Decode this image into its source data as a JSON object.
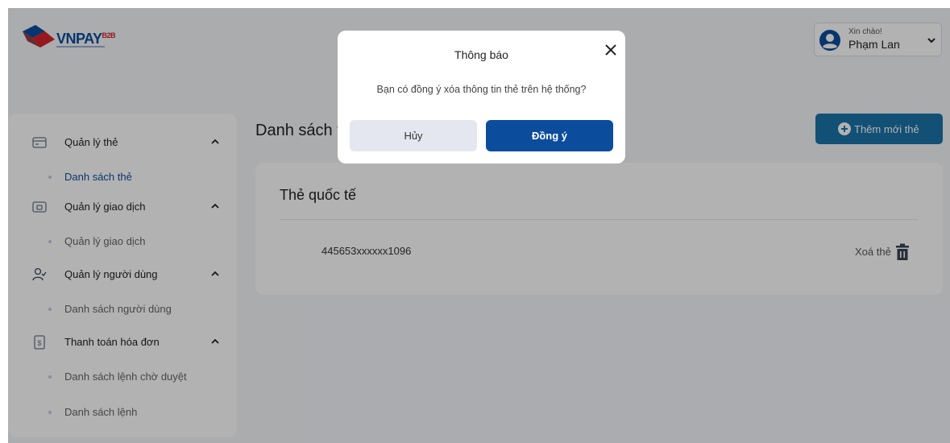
{
  "brand": {
    "logo_name": "VNPAY",
    "logo_suffix": "B2B"
  },
  "user": {
    "greeting": "Xin chào!",
    "name": "Phạm Lan"
  },
  "sidebar": {
    "groups": [
      {
        "label": "Quản lý thẻ",
        "icon": "credit-card-icon",
        "sub": "Danh sách thẻ",
        "sub_active": true
      },
      {
        "label": "Quản lý giao dịch",
        "icon": "wallet-icon",
        "sub": "Quản lý giao dịch",
        "sub_active": false
      },
      {
        "label": "Quản lý người dùng",
        "icon": "user-check-icon",
        "sub": "Danh sách người dùng",
        "sub_active": false
      },
      {
        "label": "Thanh toán hóa đơn",
        "icon": "invoice-dollar-icon",
        "subs": [
          "Danh sách lệnh chờ duyệt",
          "Danh sách lệnh"
        ]
      }
    ]
  },
  "main": {
    "title": "Danh sách thẻ",
    "add_button": "Thêm mới thẻ",
    "card": {
      "title": "Thẻ quốc tế",
      "number": "445653xxxxxx1096",
      "delete_label": "Xoá thẻ"
    }
  },
  "modal": {
    "title": "Thông báo",
    "message": "Bạn có đồng ý xóa thông tin thẻ trên hệ thống?",
    "cancel_label": "Hủy",
    "confirm_label": "Đồng ý"
  },
  "colors": {
    "primary": "#0b4d9c",
    "accent": "#1a73a8",
    "brand_red": "#d6232a",
    "overlay": "rgba(0,0,0,0.30)"
  }
}
